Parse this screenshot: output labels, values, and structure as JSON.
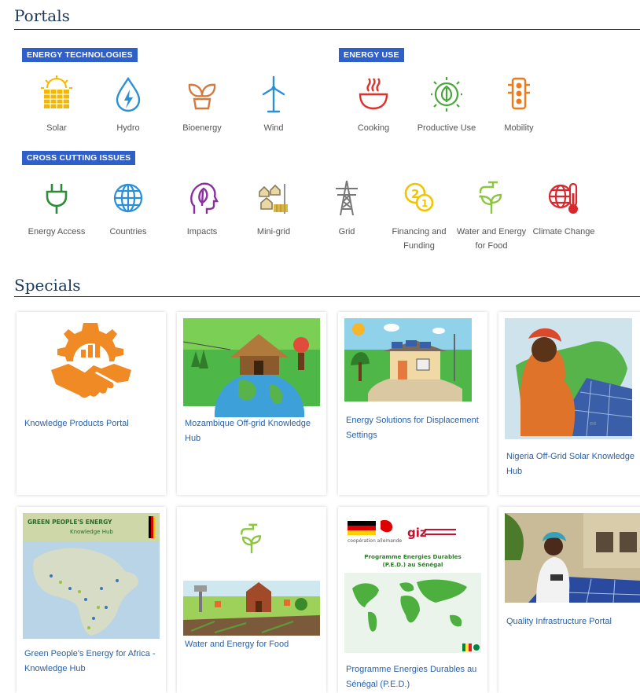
{
  "portals": {
    "title": "Portals",
    "energy_technologies": {
      "tag": "ENERGY TECHNOLOGIES",
      "items": [
        {
          "label": "Solar",
          "icon": "solar-panel-icon",
          "color": "#f5b800"
        },
        {
          "label": "Hydro",
          "icon": "water-drop-icon",
          "color": "#2b8fd6"
        },
        {
          "label": "Bioenergy",
          "icon": "sprout-icon",
          "color": "#d37a3f"
        },
        {
          "label": "Wind",
          "icon": "wind-turbine-icon",
          "color": "#2b8fd6"
        }
      ]
    },
    "energy_use": {
      "tag": "ENERGY USE",
      "items": [
        {
          "label": "Cooking",
          "icon": "cooking-pot-icon",
          "color": "#e0302a"
        },
        {
          "label": "Productive Use",
          "icon": "gear-leaf-icon",
          "color": "#4aa63a"
        },
        {
          "label": "Mobility",
          "icon": "traffic-light-icon",
          "color": "#f07a1a"
        }
      ]
    },
    "cross_cutting": {
      "tag": "CROSS CUTTING ISSUES",
      "items": [
        {
          "label": "Energy Access",
          "icon": "plug-icon",
          "color": "#2e8b3a"
        },
        {
          "label": "Countries",
          "icon": "globe-icon",
          "color": "#2b8fd6"
        },
        {
          "label": "Impacts",
          "icon": "head-leaf-icon",
          "color": "#8a2fa0"
        },
        {
          "label": "Mini-grid",
          "icon": "mini-grid-icon",
          "color": "#c9a43a"
        },
        {
          "label": "Grid",
          "icon": "power-pylon-icon",
          "color": "#777777"
        },
        {
          "label": "Financing and Funding",
          "icon": "coins-icon",
          "color": "#f2c400"
        },
        {
          "label": "Water and Energy for Food",
          "icon": "tap-plant-icon",
          "color": "#8cc63f"
        },
        {
          "label": "Climate Change",
          "icon": "globe-thermometer-icon",
          "color": "#d8282e"
        }
      ]
    }
  },
  "specials": {
    "title": "Specials",
    "cards": [
      {
        "label": "Knowledge Products Portal"
      },
      {
        "label": "Mozambique Off-grid Knowledge Hub"
      },
      {
        "label": "Energy Solutions for Displacement Settings"
      },
      {
        "label": "Nigeria Off-Grid Solar Knowledge Hub"
      },
      {
        "label": "Green People's Energy for Africa - Knowledge Hub",
        "image_title": "GREEN PEOPLE'S ENERGY",
        "image_subtitle": "Knowledge Hub"
      },
      {
        "label": "Water and Energy for Food"
      },
      {
        "label": "Programme Energies Durables au Sénégal (P.E.D.)",
        "image_title": "Programme Energies Durables (P.E.D.) au Sénégal",
        "logo_text": "giz",
        "logo_small": "coopération allemande"
      },
      {
        "label": "Quality Infrastructure Portal"
      }
    ]
  }
}
